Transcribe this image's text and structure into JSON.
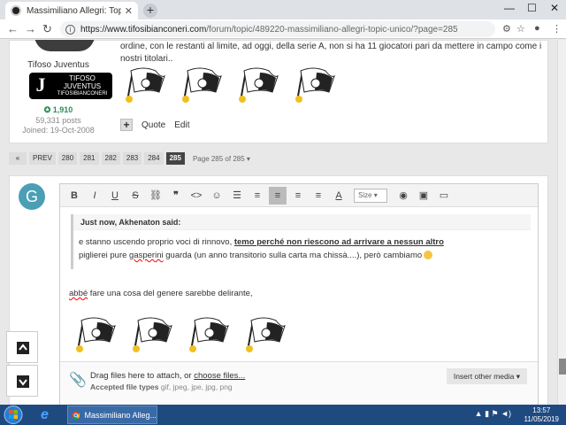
{
  "browser": {
    "tab_title": "Massimiliano Allegri: Topic Unico",
    "url_host": "https://www.tifosibianconeri.com",
    "url_path": "/forum/topic/489220-massimiliano-allegri-topic-unico/?page=285"
  },
  "post": {
    "text": "ordine, con le restanti al limite, ad oggi, della serie A, non si ha 11 giocatori pari da mettere in campo come i nostri titolari..",
    "author": "Tifoso Juventus",
    "rank_line1": "TIFOSO",
    "rank_line2": "JUVENTUS",
    "rank_line3": "TIFOSIBIANCONERI",
    "reputation": "1,910",
    "posts": "59,331 posts",
    "joined": "Joined: 19-Oct-2008",
    "quote_label": "Quote",
    "edit_label": "Edit"
  },
  "pagination": {
    "first": "«",
    "prev": "PREV",
    "pages": [
      "280",
      "281",
      "282",
      "283",
      "284"
    ],
    "current": "285",
    "info": "Page 285 of 285"
  },
  "editor": {
    "avatar_letter": "G",
    "size_label": "Size",
    "quote_header": "Just now, Akhenaton said:",
    "quote_line1_a": "e stanno uscendo proprio voci di rinnovo, ",
    "quote_line1_b": "temo perché non riescono ad arrivare a nessun altro",
    "quote_line2_a": "piglierei pure ",
    "quote_line2_spell": "gasperini",
    "quote_line2_b": " guarda (un anno transitorio sulla carta ma chissà....), però cambiamo",
    "reply_spell": "abbé",
    "reply_rest": " fare una cosa del genere sarebbe delirante,",
    "drag_text": "Drag files here to attach, or ",
    "choose_files": "choose files...",
    "types_label": "Accepted file types",
    "types_value": " gif, jpeg, jpe, jpg, png",
    "insert_media": "Insert other media"
  },
  "taskbar": {
    "chrome_label": "Massimiliano Alleg...",
    "time": "13:57",
    "date": "11/05/2019"
  }
}
